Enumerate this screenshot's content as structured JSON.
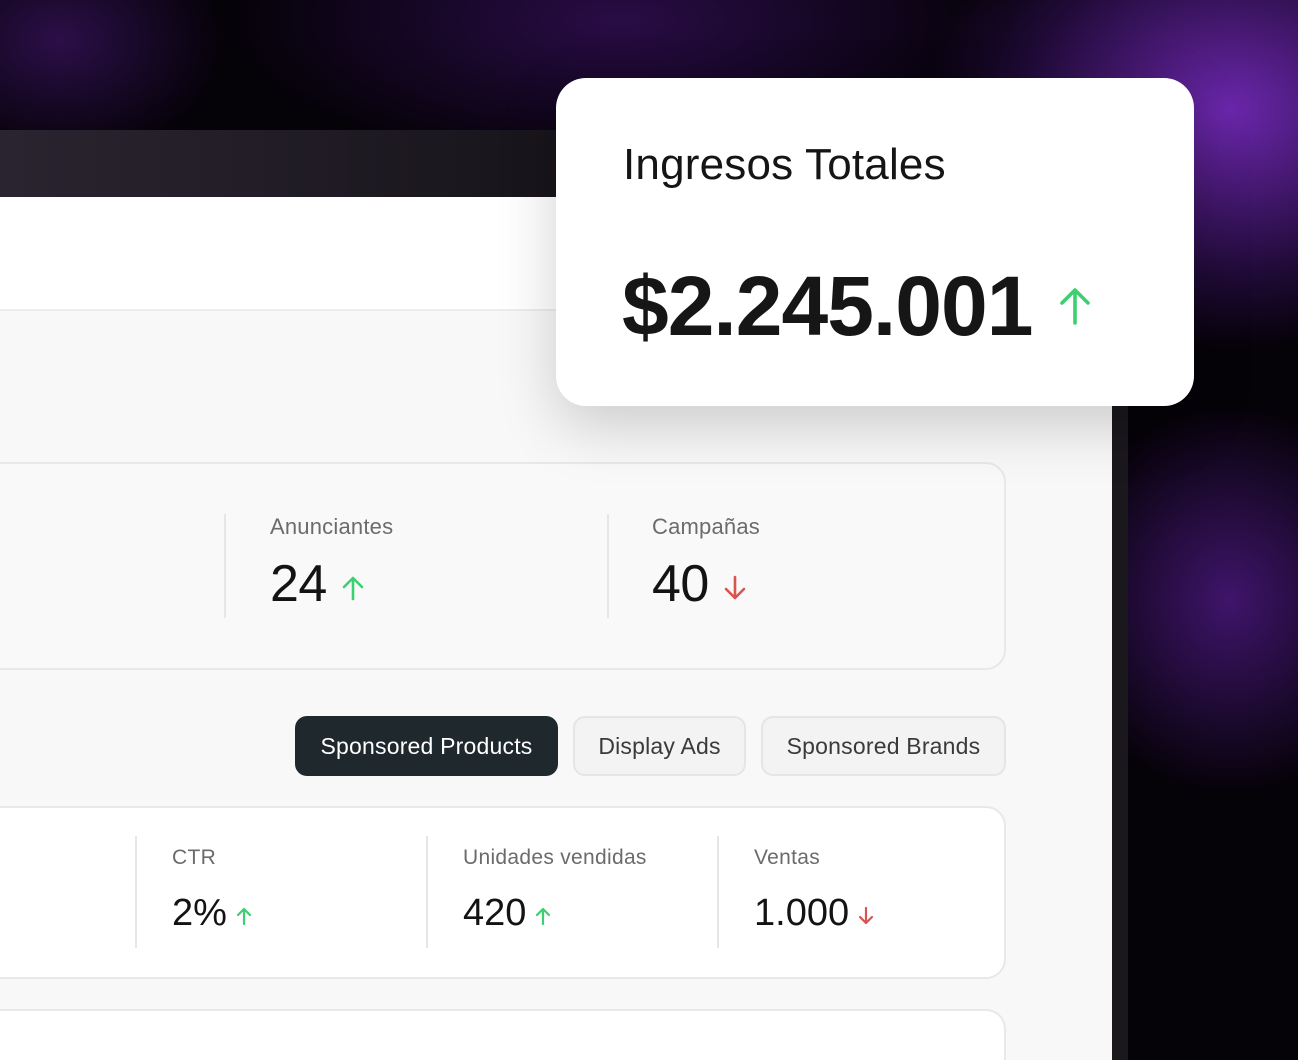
{
  "total_revenue": {
    "title": "Ingresos Totales",
    "value": "$2.245.001",
    "trend": "up"
  },
  "summary": {
    "advertisers": {
      "label": "Anunciantes",
      "value": "24",
      "trend": "up"
    },
    "campaigns": {
      "label": "Campañas",
      "value": "40",
      "trend": "down"
    }
  },
  "tabs": [
    {
      "label": "Sponsored Products",
      "active": true
    },
    {
      "label": "Display Ads",
      "active": false
    },
    {
      "label": "Sponsored Brands",
      "active": false
    }
  ],
  "metrics": {
    "ctr": {
      "label": "CTR",
      "value": "2%",
      "trend": "up"
    },
    "units_sold": {
      "label": "Unidades vendidas",
      "value": "420",
      "trend": "up"
    },
    "sales": {
      "label": "Ventas",
      "value": "1.000",
      "trend": "down"
    }
  },
  "icons": {
    "trend_up": "arrow-up-icon",
    "trend_down": "arrow-down-icon"
  },
  "colors": {
    "trend_up": "#3ecf71",
    "trend_down": "#d9534f",
    "active_tab_bg": "#1f292d",
    "accent_purple": "#7b2cbf"
  }
}
